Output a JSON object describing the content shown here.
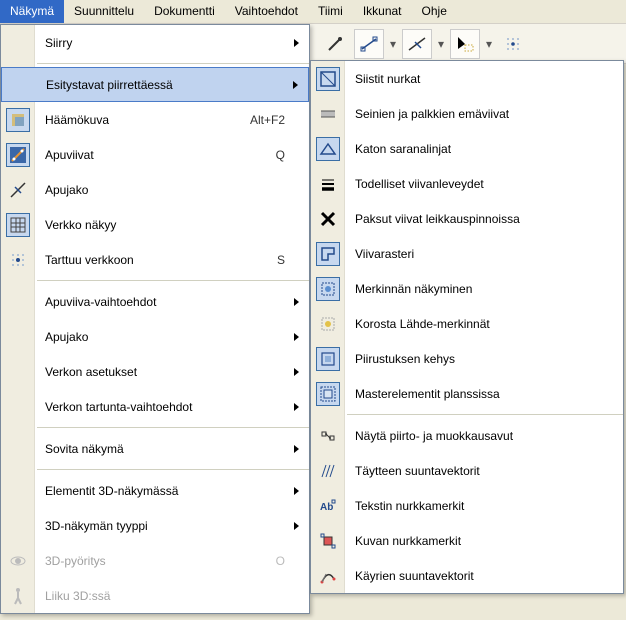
{
  "menubar": {
    "items": [
      {
        "label": "Näkymä",
        "active": true
      },
      {
        "label": "Suunnittelu"
      },
      {
        "label": "Dokumentti"
      },
      {
        "label": "Vaihtoehdot"
      },
      {
        "label": "Tiimi"
      },
      {
        "label": "Ikkunat"
      },
      {
        "label": "Ohje"
      }
    ]
  },
  "menu": {
    "siirry": "Siirry",
    "esitystavat": "Esitystavat piirrettäessä",
    "haamokuva": "Häämökuva",
    "haamokuva_sc": "Alt+F2",
    "apuviivat": "Apuviivat",
    "apuviivat_sc": "Q",
    "apujako": "Apujako",
    "verkko_nakyy": "Verkko näkyy",
    "tarttuu_verkkoon": "Tarttuu verkkoon",
    "tarttuu_verkkoon_sc": "S",
    "apuviiva_vaihtoehdot": "Apuviiva-vaihtoehdot",
    "apujako2": "Apujako",
    "verkon_asetukset": "Verkon asetukset",
    "verkon_tartunta": "Verkon tartunta-vaihtoehdot",
    "sovita_nakyma": "Sovita näkymä",
    "elementit_3d": "Elementit 3D-näkymässä",
    "nakyma_tyyppi": "3D-näkymän tyyppi",
    "pyoritys": "3D-pyöritys",
    "pyoritys_sc": "O",
    "liiku_3d": "Liiku 3D:ssä"
  },
  "submenu": {
    "siistit_nurkat": "Siistit nurkat",
    "seinien": "Seinien ja palkkien emäviivat",
    "katon": "Katon saranalinjat",
    "todelliset": "Todelliset viivanleveydet",
    "paksut": "Paksut viivat leikkauspinnoissa",
    "viivarasteri": "Viivarasteri",
    "merkinnan": "Merkinnän näkyminen",
    "korosta": "Korosta Lähde-merkinnät",
    "piirustuksen": "Piirustuksen kehys",
    "masterelementit": "Masterelementit planssissa",
    "nayta_piirto": "Näytä piirto- ja muokkausavut",
    "taytteen": "Täytteen suuntavektorit",
    "tekstin": "Tekstin nurkkamerkit",
    "kuvan": "Kuvan nurkkamerkit",
    "kayrien": "Käyrien suuntavektorit"
  }
}
